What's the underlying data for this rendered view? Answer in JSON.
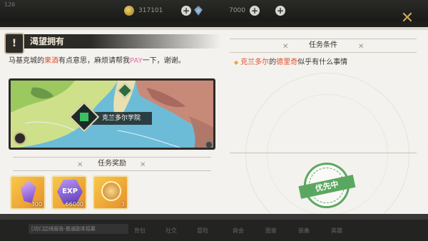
{
  "hud": {
    "level_text": "126",
    "gold": "317101",
    "gems": "7000"
  },
  "quest": {
    "icon_glyph": "!",
    "title": "渴望拥有",
    "desc_pre": "马基克城的",
    "desc_hl": "果酒",
    "desc_mid": "有点意思，麻烦请帮我",
    "desc_pay": "PAY",
    "desc_post": "一下，谢谢。",
    "location": "克兰多尔学院"
  },
  "rewards": {
    "header": "任务奖励",
    "items": [
      {
        "name": "crystal",
        "count": "300"
      },
      {
        "name": "exp",
        "label": "EXP",
        "count": "66000"
      },
      {
        "name": "medal",
        "count": "3"
      }
    ]
  },
  "conditions": {
    "header": "任务条件",
    "place": "克兰多尔",
    "connector": "的",
    "person": "德里奇",
    "rest": "似乎有什么事情"
  },
  "stamp": "优先中",
  "bottom": {
    "chat": "[坑C]边境报告-普通副本招募",
    "nav": [
      "背包",
      "社交",
      "冒险",
      "商会",
      "图鉴",
      "装备",
      "英雄"
    ]
  },
  "colors": {
    "highlight": "#e05030",
    "pay": "#e070b0",
    "stamp": "#5aa860",
    "gold_accent": "#c9a85a"
  }
}
